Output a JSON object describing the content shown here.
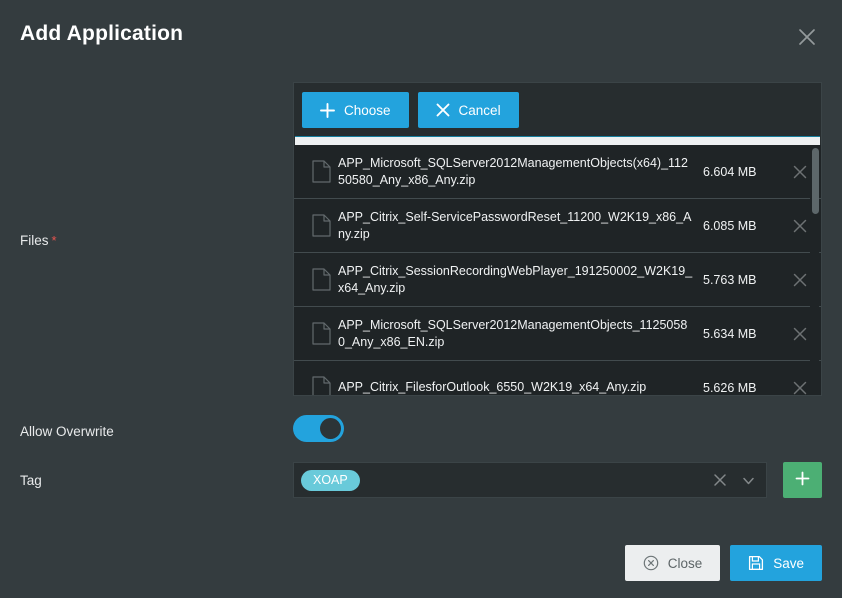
{
  "dialog": {
    "title": "Add Application",
    "close_icon": "close-icon"
  },
  "fields": {
    "files_label": "Files",
    "files_required_mark": "*",
    "allow_overwrite_label": "Allow Overwrite",
    "tag_label": "Tag"
  },
  "upload": {
    "choose_label": "Choose",
    "cancel_label": "Cancel",
    "choose_icon": "plus-icon",
    "cancel_icon": "close-icon",
    "progress_percent": 100,
    "files": [
      {
        "name": "APP_Microsoft_SQLServer2012ManagementObjects(x64)_11250580_Any_x86_Any.zip",
        "size": "6.604 MB"
      },
      {
        "name": "APP_Citrix_Self-ServicePasswordReset_11200_W2K19_x86_Any.zip",
        "size": "6.085 MB"
      },
      {
        "name": "APP_Citrix_SessionRecordingWebPlayer_191250002_W2K19_x64_Any.zip",
        "size": "5.763 MB"
      },
      {
        "name": "APP_Microsoft_SQLServer2012ManagementObjects_11250580_Any_x86_EN.zip",
        "size": "5.634 MB"
      },
      {
        "name": "APP_Citrix_FilesforOutlook_6550_W2K19_x64_Any.zip",
        "size": "5.626 MB"
      }
    ]
  },
  "allow_overwrite": {
    "state": "on"
  },
  "tag": {
    "chips": [
      "XOAP"
    ],
    "placeholder": "",
    "clear_icon": "close-icon",
    "dropdown_icon": "chevron-down-icon",
    "add_icon": "plus-icon"
  },
  "footer": {
    "close_label": "Close",
    "close_icon": "circle-close-icon",
    "save_label": "Save",
    "save_icon": "save-disk-icon"
  },
  "colors": {
    "dialog_bg": "#343c3f",
    "panel_bg": "#272d2f",
    "list_bg": "#1f2426",
    "accent_blue": "#23a3dd",
    "accent_green": "#4caf74",
    "chip_teal": "#69cada",
    "required_red": "#e8544f",
    "light_button": "#eceeef"
  }
}
